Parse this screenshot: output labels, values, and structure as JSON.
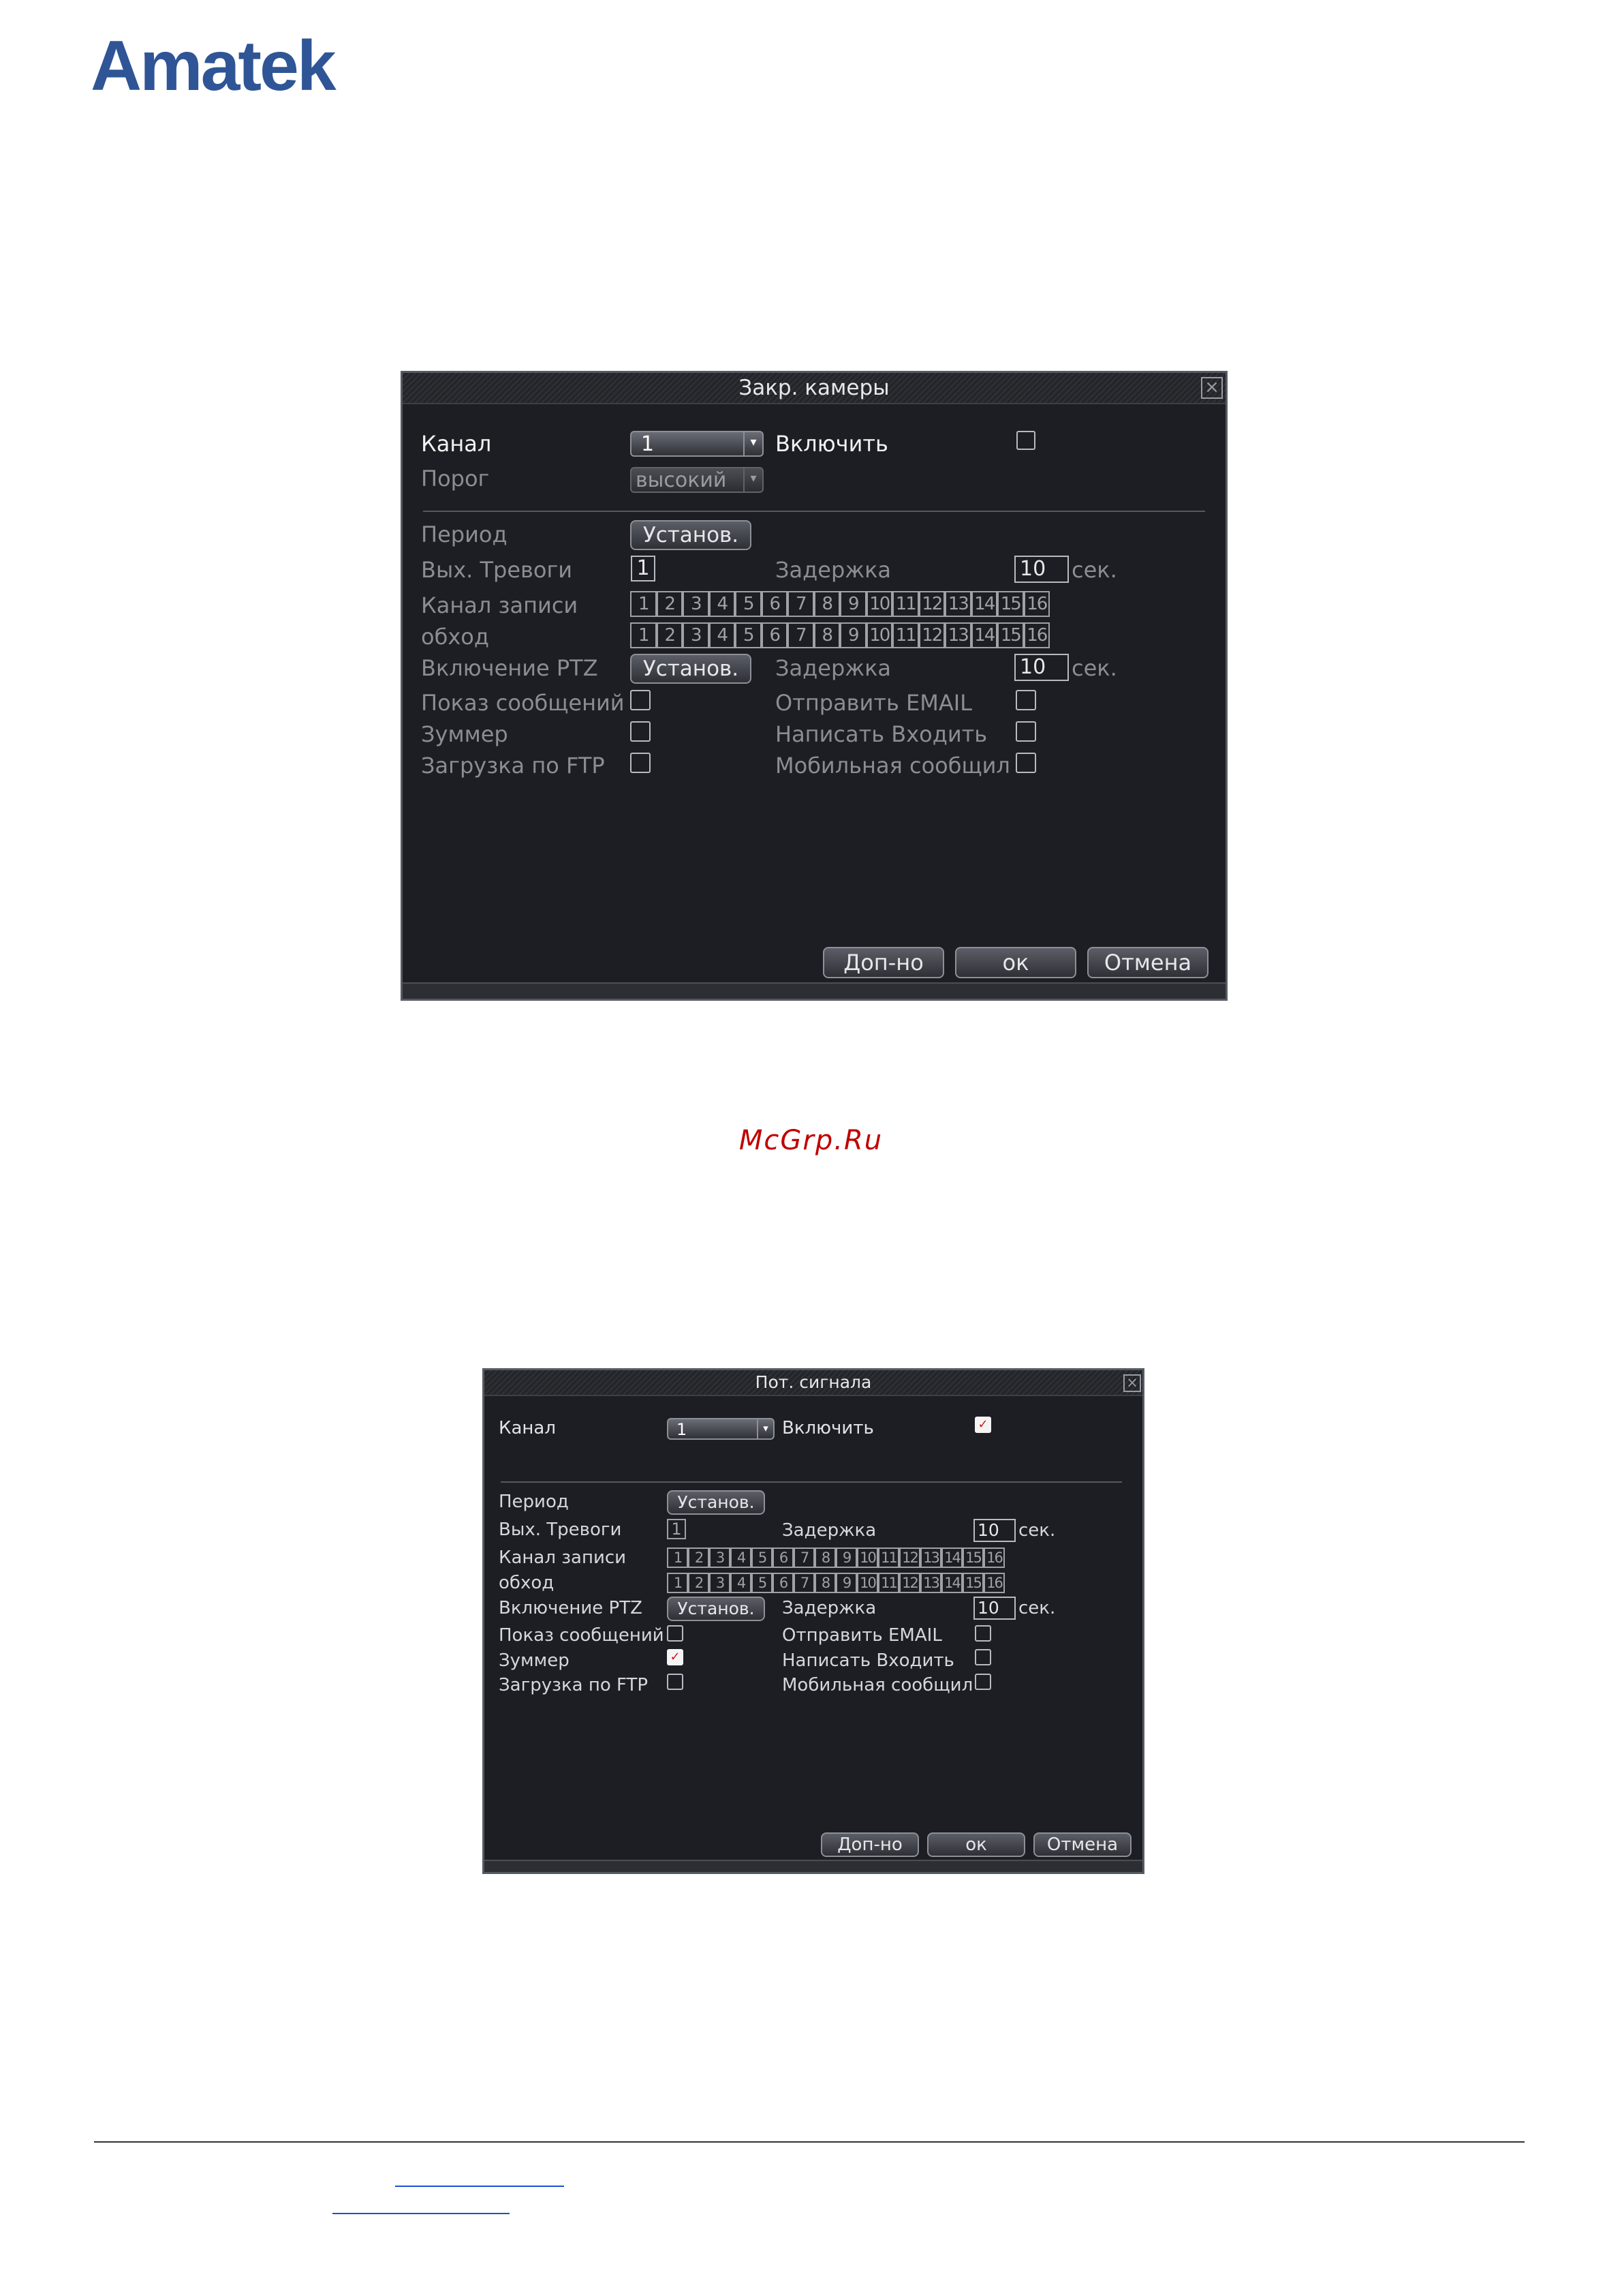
{
  "page": {
    "logo": "Amatek",
    "watermark": "McGrp.Ru"
  },
  "dialog1": {
    "title": "Закр. камеры",
    "channel_label": "Канал",
    "channel_value": "1",
    "enable_label": "Включить",
    "enable_checked": false,
    "threshold_label": "Порог",
    "threshold_value": "высокий",
    "period_label": "Период",
    "period_button": "Установ.",
    "alarm_out_label": "Вых. Тревоги",
    "alarm_out_value": "1",
    "delay1_label": "Задержка",
    "delay1_value": "10",
    "delay1_unit": "сек.",
    "record_channel_label": "Канал записи",
    "tour_label": "обход",
    "channels": [
      "1",
      "2",
      "3",
      "4",
      "5",
      "6",
      "7",
      "8",
      "9",
      "10",
      "11",
      "12",
      "13",
      "14",
      "15",
      "16"
    ],
    "ptz_label": "Включение PTZ",
    "ptz_button": "Установ.",
    "delay2_label": "Задержка",
    "delay2_value": "10",
    "delay2_unit": "сек.",
    "show_message_label": "Показ сообщений",
    "show_message_checked": false,
    "send_email_label": "Отправить EMAIL",
    "send_email_checked": false,
    "buzzer_label": "Зуммер",
    "buzzer_checked": false,
    "write_log_label": "Написать Входить",
    "write_log_checked": false,
    "ftp_label": "Загрузка по FTP",
    "ftp_checked": false,
    "mobile_label": "Мобильная сообщил",
    "mobile_checked": false,
    "advanced_button": "Доп-но",
    "ok_button": "ок",
    "cancel_button": "Отмена"
  },
  "dialog2": {
    "title": "Пот. сигнала",
    "channel_label": "Канал",
    "channel_value": "1",
    "enable_label": "Включить",
    "enable_checked": true,
    "period_label": "Период",
    "period_button": "Установ.",
    "alarm_out_label": "Вых. Тревоги",
    "alarm_out_value": "1",
    "delay1_label": "Задержка",
    "delay1_value": "10",
    "delay1_unit": "сек.",
    "record_channel_label": "Канал записи",
    "tour_label": "обход",
    "channels": [
      "1",
      "2",
      "3",
      "4",
      "5",
      "6",
      "7",
      "8",
      "9",
      "10",
      "11",
      "12",
      "13",
      "14",
      "15",
      "16"
    ],
    "ptz_label": "Включение PTZ",
    "ptz_button": "Установ.",
    "delay2_label": "Задержка",
    "delay2_value": "10",
    "delay2_unit": "сек.",
    "show_message_label": "Показ сообщений",
    "show_message_checked": false,
    "send_email_label": "Отправить EMAIL",
    "send_email_checked": false,
    "buzzer_label": "Зуммер",
    "buzzer_checked": true,
    "write_log_label": "Написать Входить",
    "write_log_checked": false,
    "ftp_label": "Загрузка по FTP",
    "ftp_checked": false,
    "mobile_label": "Мобильная сообщил",
    "mobile_checked": false,
    "advanced_button": "Доп-но",
    "ok_button": "ок",
    "cancel_button": "Отмена"
  }
}
